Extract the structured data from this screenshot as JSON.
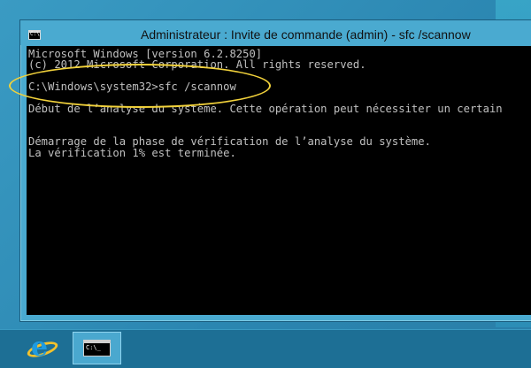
{
  "window": {
    "title": "Administrateur : Invite de commande (admin) - sfc  /scannow",
    "icon_name": "cmd-icon",
    "icon_text": "C:\\"
  },
  "console": {
    "lines": [
      "Microsoft Windows [version 6.2.8250]",
      "(c) 2012 Microsoft Corporation. All rights reserved.",
      "",
      "C:\\Windows\\system32>sfc /scannow",
      "",
      "Début de l’analyse du système. Cette opération peut nécessiter un certain",
      "",
      "",
      "Démarrage de la phase de vérification de l’analyse du système.",
      "La vérification 1% est terminée."
    ],
    "text_color": "#c0c0c0",
    "background": "#000000"
  },
  "annotation": {
    "highlight_color": "#f2d23b",
    "highlight_target": "command-line"
  },
  "taskbar": {
    "items": [
      {
        "name": "internet-explorer",
        "icon": "ie-icon",
        "glyph": "e"
      },
      {
        "name": "command-prompt",
        "icon": "cmd-icon",
        "glyph": "C:\\_",
        "active": true
      }
    ]
  }
}
